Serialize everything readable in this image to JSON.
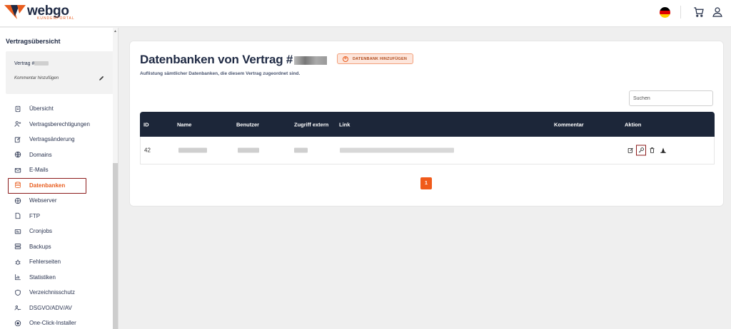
{
  "header": {
    "logo_text": "webgo",
    "logo_subtext": "KUNDENPORTAL",
    "colors": {
      "brand_orange": "#e85d1f",
      "navy": "#1f2a44"
    }
  },
  "sidebar": {
    "title": "Vertragsübersicht",
    "contract_label": "Vertrag #",
    "comment_placeholder": "Kommentar hinzufügen",
    "items": [
      {
        "label": "Übersicht",
        "icon": "document-icon"
      },
      {
        "label": "Vertragsberechtigungen",
        "icon": "user-plus-icon"
      },
      {
        "label": "Vertragsänderung",
        "icon": "edit-icon"
      },
      {
        "label": "Domains",
        "icon": "globe-icon"
      },
      {
        "label": "E-Mails",
        "icon": "mail-icon"
      },
      {
        "label": "Datenbanken",
        "icon": "database-icon",
        "active": true
      },
      {
        "label": "Webserver",
        "icon": "server-globe-icon"
      },
      {
        "label": "FTP",
        "icon": "file-icon"
      },
      {
        "label": "Cronjobs",
        "icon": "clock-icon"
      },
      {
        "label": "Backups",
        "icon": "backup-icon"
      },
      {
        "label": "Fehlerseiten",
        "icon": "bug-icon"
      },
      {
        "label": "Statistiken",
        "icon": "chart-icon"
      },
      {
        "label": "Verzeichnisschutz",
        "icon": "shield-icon"
      },
      {
        "label": "DSGVO/ADV/AV",
        "icon": "users-icon"
      },
      {
        "label": "One-Click-Installer",
        "icon": "install-icon"
      }
    ]
  },
  "main": {
    "title": "Datenbanken von Vertrag #",
    "add_button": "DATENBANK HINZUFÜGEN",
    "subtitle": "Auflistung sämtlicher Datenbanken, die diesem Vertrag zugeordnet sind.",
    "search_placeholder": "Suchen",
    "table": {
      "headers": [
        "ID",
        "Name",
        "Benutzer",
        "Zugriff extern",
        "Link",
        "Kommentar",
        "Aktion"
      ],
      "rows": [
        {
          "id": "42"
        }
      ]
    },
    "pagination": {
      "current_page": "1"
    }
  }
}
